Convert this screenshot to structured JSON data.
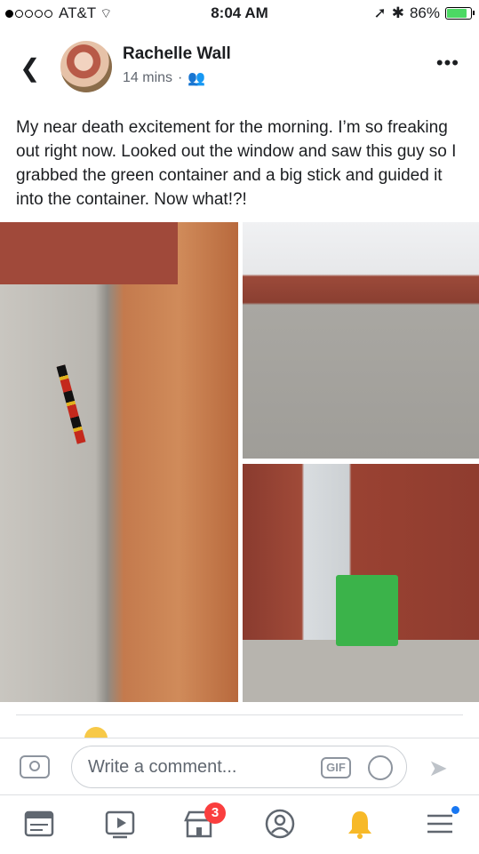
{
  "status_bar": {
    "carrier": "AT&T",
    "time": "8:04 AM",
    "battery": "86%"
  },
  "post": {
    "author": "Rachelle Wall",
    "time": "14 mins",
    "text": "My near death excitement for the morning. I’m so freaking out right now. Looked out the window and saw this guy so I grabbed the green container and a big stick and guided it into the container. Now what!?!"
  },
  "comment_bar": {
    "placeholder": "Write a comment...",
    "gif_label": "GIF"
  },
  "tab_bar": {
    "notifications_badge": "3"
  },
  "colors": {
    "accent": "#1877f2",
    "badge": "#fa3e3e",
    "notification_bell": "#f7b928"
  },
  "icons": [
    "back-chevron-icon",
    "friends-icon",
    "more-icon",
    "camera-icon",
    "gif-icon",
    "emoji-icon",
    "send-icon",
    "news-feed-icon",
    "video-icon",
    "marketplace-icon",
    "profile-icon",
    "bell-icon",
    "menu-icon"
  ]
}
